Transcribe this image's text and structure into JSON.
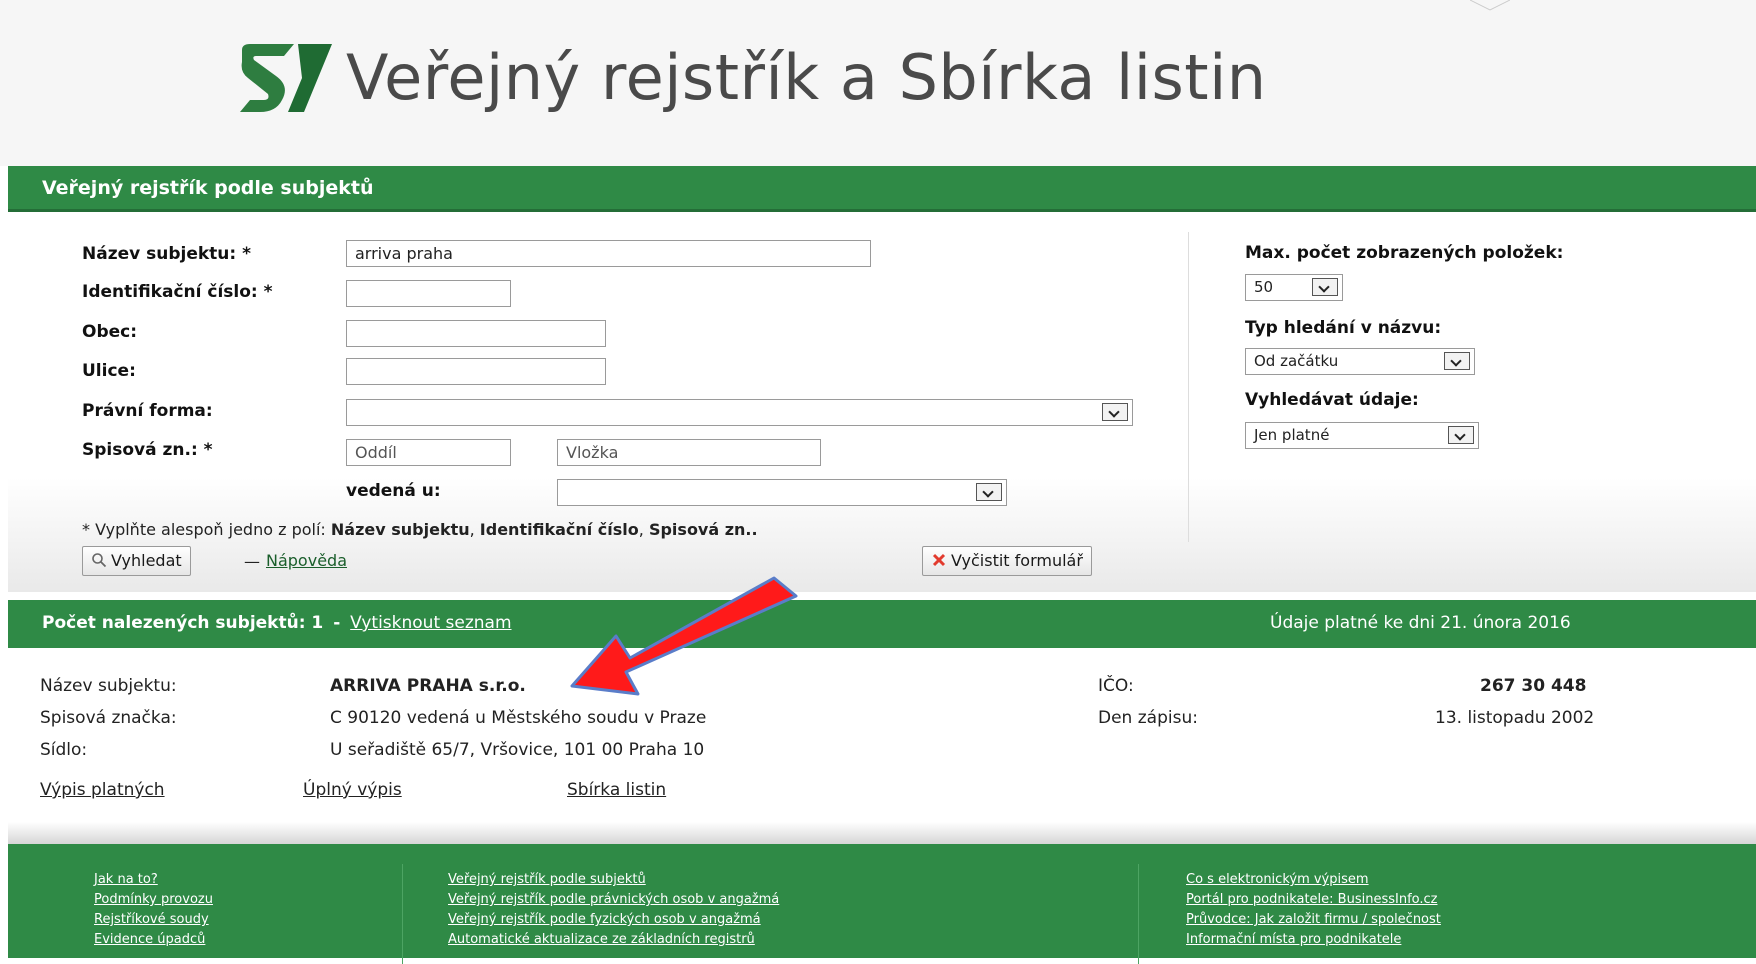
{
  "header": {
    "title": "Veřejný rejstřík a Sbírka listin",
    "logo": "justice-s-logo-icon"
  },
  "search_section": {
    "heading": "Veřejný rejstřík podle subjektů",
    "fields": {
      "nazev_label": "Název subjektu: *",
      "nazev_value": "arriva praha",
      "ico_label": "Identifikační číslo: *",
      "obec_label": "Obec:",
      "ulice_label": "Ulice:",
      "pravni_forma_label": "Právní forma:",
      "spisova_label": "Spisová zn.: *",
      "oddil_placeholder": "Oddíl",
      "vlozka_placeholder": "Vložka",
      "vedena_label": "vedená u:"
    },
    "right": {
      "max_label": "Max. počet zobrazených položek:",
      "max_value": "50",
      "typ_label": "Typ hledání v názvu:",
      "typ_value": "Od začátku",
      "vyhledavat_label": "Vyhledávat údaje:",
      "vyhledavat_value": "Jen platné"
    },
    "note_prefix": "* Vyplňte alespoň jedno z polí:",
    "note_f1": "Název subjektu",
    "note_f2": "Identifikační číslo",
    "note_f3": "Spisová zn..",
    "search_button": "Vyhledat",
    "dash": "—",
    "help_link": "Nápověda",
    "clear_button": "Vyčistit formulář"
  },
  "results": {
    "count_label": "Počet nalezených subjektů: 1",
    "sep": "-",
    "print_link": "Vytisknout seznam",
    "valid_as_of": "Údaje platné ke dni 21. února 2016",
    "item": {
      "nazev_label": "Název subjektu:",
      "nazev_value": "ARRIVA PRAHA s.r.o.",
      "spisova_label": "Spisová značka:",
      "spisova_value": "C 90120 vedená u Městského soudu v Praze",
      "sidlo_label": "Sídlo:",
      "sidlo_value": "U seřadiště 65/7, Vršovice, 101 00 Praha 10",
      "ico_label": "IČO:",
      "ico_value": "267 30 448",
      "den_label": "Den zápisu:",
      "den_value": "13. listopadu 2002",
      "links": [
        "Výpis platných",
        "Úplný výpis",
        "Sbírka listin"
      ]
    }
  },
  "footer": {
    "col1": [
      "Jak na to?",
      "Podmínky provozu",
      "Rejstříkové soudy",
      "Evidence úpadců"
    ],
    "col2": [
      "Veřejný rejstřík podle subjektů",
      "Veřejný rejstřík podle právnických osob v angažmá",
      "Veřejný rejstřík podle fyzických osob v angažmá",
      "Automatické aktualizace ze základních registrů"
    ],
    "col3": [
      "Co s elektronickým výpisem",
      "Portál pro podnikatele: BusinessInfo.cz",
      "Průvodce: Jak založit firmu / společnost",
      "Informační místa pro podnikatele"
    ]
  },
  "colors": {
    "brand_green": "#2f8a46",
    "annotation_arrow": "#ff0000"
  }
}
